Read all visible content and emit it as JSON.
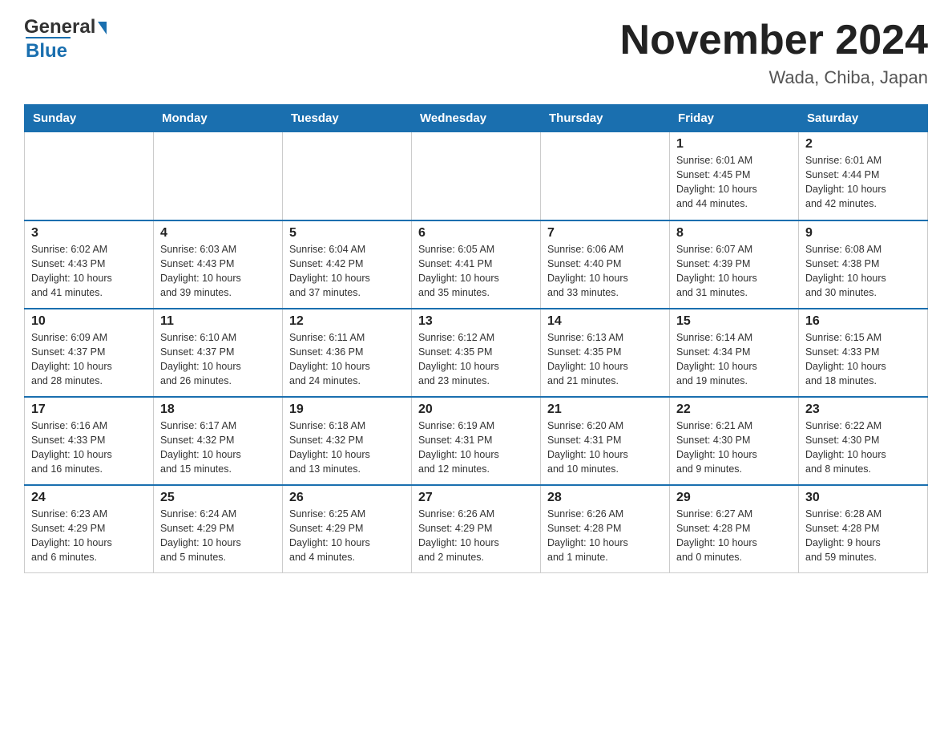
{
  "header": {
    "logo_general": "General",
    "logo_blue": "Blue",
    "month_title": "November 2024",
    "location": "Wada, Chiba, Japan"
  },
  "days_of_week": [
    "Sunday",
    "Monday",
    "Tuesday",
    "Wednesday",
    "Thursday",
    "Friday",
    "Saturday"
  ],
  "weeks": [
    {
      "days": [
        {
          "num": "",
          "info": ""
        },
        {
          "num": "",
          "info": ""
        },
        {
          "num": "",
          "info": ""
        },
        {
          "num": "",
          "info": ""
        },
        {
          "num": "",
          "info": ""
        },
        {
          "num": "1",
          "info": "Sunrise: 6:01 AM\nSunset: 4:45 PM\nDaylight: 10 hours\nand 44 minutes."
        },
        {
          "num": "2",
          "info": "Sunrise: 6:01 AM\nSunset: 4:44 PM\nDaylight: 10 hours\nand 42 minutes."
        }
      ]
    },
    {
      "days": [
        {
          "num": "3",
          "info": "Sunrise: 6:02 AM\nSunset: 4:43 PM\nDaylight: 10 hours\nand 41 minutes."
        },
        {
          "num": "4",
          "info": "Sunrise: 6:03 AM\nSunset: 4:43 PM\nDaylight: 10 hours\nand 39 minutes."
        },
        {
          "num": "5",
          "info": "Sunrise: 6:04 AM\nSunset: 4:42 PM\nDaylight: 10 hours\nand 37 minutes."
        },
        {
          "num": "6",
          "info": "Sunrise: 6:05 AM\nSunset: 4:41 PM\nDaylight: 10 hours\nand 35 minutes."
        },
        {
          "num": "7",
          "info": "Sunrise: 6:06 AM\nSunset: 4:40 PM\nDaylight: 10 hours\nand 33 minutes."
        },
        {
          "num": "8",
          "info": "Sunrise: 6:07 AM\nSunset: 4:39 PM\nDaylight: 10 hours\nand 31 minutes."
        },
        {
          "num": "9",
          "info": "Sunrise: 6:08 AM\nSunset: 4:38 PM\nDaylight: 10 hours\nand 30 minutes."
        }
      ]
    },
    {
      "days": [
        {
          "num": "10",
          "info": "Sunrise: 6:09 AM\nSunset: 4:37 PM\nDaylight: 10 hours\nand 28 minutes."
        },
        {
          "num": "11",
          "info": "Sunrise: 6:10 AM\nSunset: 4:37 PM\nDaylight: 10 hours\nand 26 minutes."
        },
        {
          "num": "12",
          "info": "Sunrise: 6:11 AM\nSunset: 4:36 PM\nDaylight: 10 hours\nand 24 minutes."
        },
        {
          "num": "13",
          "info": "Sunrise: 6:12 AM\nSunset: 4:35 PM\nDaylight: 10 hours\nand 23 minutes."
        },
        {
          "num": "14",
          "info": "Sunrise: 6:13 AM\nSunset: 4:35 PM\nDaylight: 10 hours\nand 21 minutes."
        },
        {
          "num": "15",
          "info": "Sunrise: 6:14 AM\nSunset: 4:34 PM\nDaylight: 10 hours\nand 19 minutes."
        },
        {
          "num": "16",
          "info": "Sunrise: 6:15 AM\nSunset: 4:33 PM\nDaylight: 10 hours\nand 18 minutes."
        }
      ]
    },
    {
      "days": [
        {
          "num": "17",
          "info": "Sunrise: 6:16 AM\nSunset: 4:33 PM\nDaylight: 10 hours\nand 16 minutes."
        },
        {
          "num": "18",
          "info": "Sunrise: 6:17 AM\nSunset: 4:32 PM\nDaylight: 10 hours\nand 15 minutes."
        },
        {
          "num": "19",
          "info": "Sunrise: 6:18 AM\nSunset: 4:32 PM\nDaylight: 10 hours\nand 13 minutes."
        },
        {
          "num": "20",
          "info": "Sunrise: 6:19 AM\nSunset: 4:31 PM\nDaylight: 10 hours\nand 12 minutes."
        },
        {
          "num": "21",
          "info": "Sunrise: 6:20 AM\nSunset: 4:31 PM\nDaylight: 10 hours\nand 10 minutes."
        },
        {
          "num": "22",
          "info": "Sunrise: 6:21 AM\nSunset: 4:30 PM\nDaylight: 10 hours\nand 9 minutes."
        },
        {
          "num": "23",
          "info": "Sunrise: 6:22 AM\nSunset: 4:30 PM\nDaylight: 10 hours\nand 8 minutes."
        }
      ]
    },
    {
      "days": [
        {
          "num": "24",
          "info": "Sunrise: 6:23 AM\nSunset: 4:29 PM\nDaylight: 10 hours\nand 6 minutes."
        },
        {
          "num": "25",
          "info": "Sunrise: 6:24 AM\nSunset: 4:29 PM\nDaylight: 10 hours\nand 5 minutes."
        },
        {
          "num": "26",
          "info": "Sunrise: 6:25 AM\nSunset: 4:29 PM\nDaylight: 10 hours\nand 4 minutes."
        },
        {
          "num": "27",
          "info": "Sunrise: 6:26 AM\nSunset: 4:29 PM\nDaylight: 10 hours\nand 2 minutes."
        },
        {
          "num": "28",
          "info": "Sunrise: 6:26 AM\nSunset: 4:28 PM\nDaylight: 10 hours\nand 1 minute."
        },
        {
          "num": "29",
          "info": "Sunrise: 6:27 AM\nSunset: 4:28 PM\nDaylight: 10 hours\nand 0 minutes."
        },
        {
          "num": "30",
          "info": "Sunrise: 6:28 AM\nSunset: 4:28 PM\nDaylight: 9 hours\nand 59 minutes."
        }
      ]
    }
  ]
}
